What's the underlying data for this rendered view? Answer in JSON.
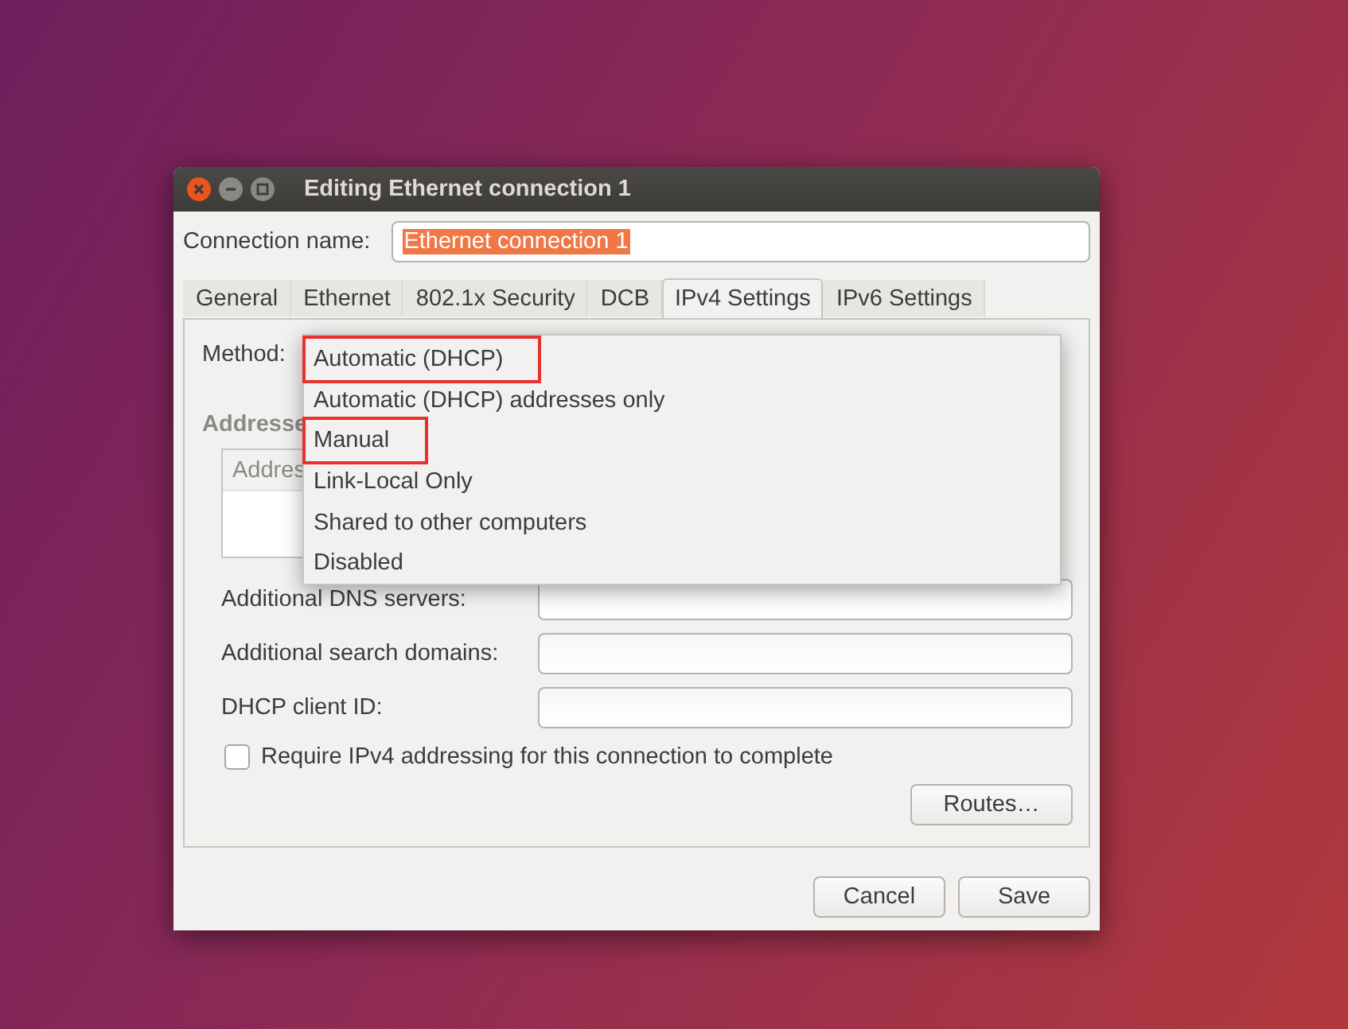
{
  "window": {
    "title": "Editing Ethernet connection 1"
  },
  "connection_name": {
    "label": "Connection name:",
    "value": "Ethernet connection 1"
  },
  "tabs": [
    {
      "label": "General",
      "selected": false
    },
    {
      "label": "Ethernet",
      "selected": false
    },
    {
      "label": "802.1x Security",
      "selected": false
    },
    {
      "label": "DCB",
      "selected": false
    },
    {
      "label": "IPv4 Settings",
      "selected": true
    },
    {
      "label": "IPv6 Settings",
      "selected": false
    }
  ],
  "method": {
    "label": "Method:"
  },
  "addresses": {
    "label": "Addresse",
    "column_1": "Addres"
  },
  "fields": [
    {
      "label": "Additional DNS servers:"
    },
    {
      "label": "Additional search domains:"
    },
    {
      "label": "DHCP client ID:"
    }
  ],
  "require_checkbox": {
    "label": "Require IPv4 addressing for this connection to complete",
    "checked": false
  },
  "routes_button": "Routes…",
  "dropdown": [
    {
      "label": "Automatic (DHCP)",
      "marked": true
    },
    {
      "label": "Automatic (DHCP) addresses only",
      "marked": false
    },
    {
      "label": "Manual",
      "marked": true
    },
    {
      "label": "Link-Local Only",
      "marked": false
    },
    {
      "label": "Shared to other computers",
      "marked": false
    },
    {
      "label": "Disabled",
      "marked": false
    }
  ],
  "buttons": [
    "Cancel",
    "Save"
  ]
}
